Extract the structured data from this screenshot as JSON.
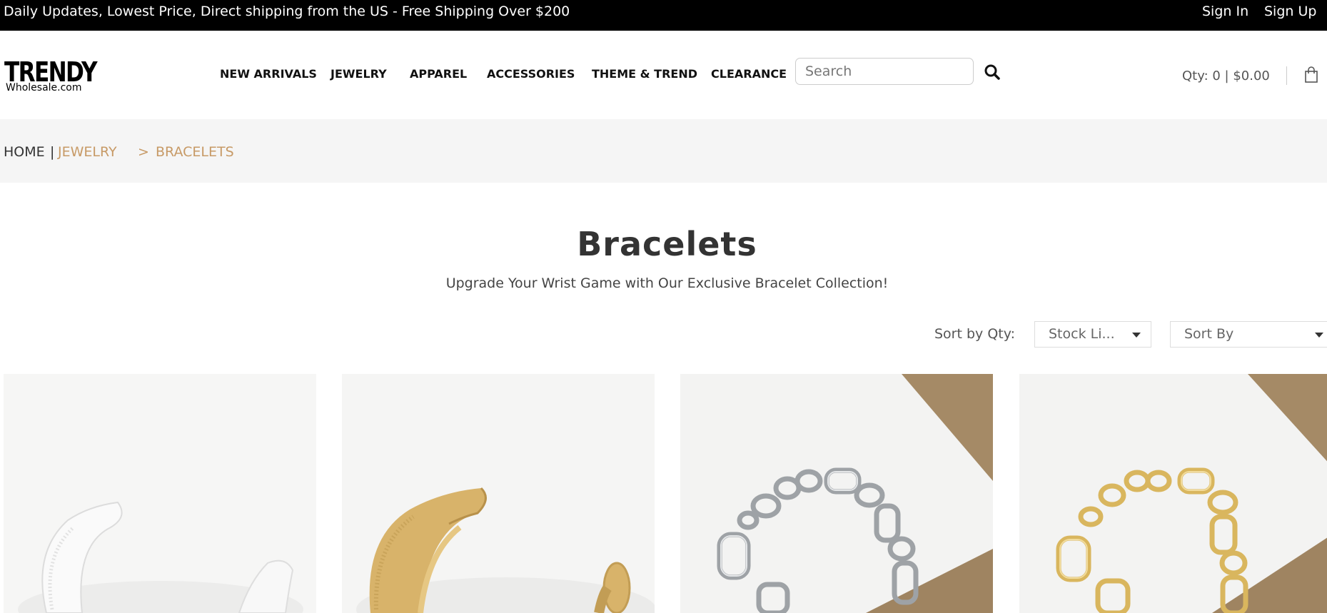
{
  "topbar": {
    "promo": "Daily Updates, Lowest Price, Direct shipping from the US - Free Shipping Over $200",
    "sign_in": "Sign In",
    "sign_up": "Sign Up"
  },
  "header": {
    "logo_main": "TRENDY",
    "logo_sub": "Wholesale.com",
    "nav": [
      "NEW ARRIVALS",
      "JEWELRY",
      "APPAREL",
      "ACCESSORIES",
      "THEME & TREND",
      "CLEARANCE"
    ],
    "search_placeholder": "Search",
    "cart": "Qty: 0 | $0.00"
  },
  "breadcrumb": {
    "home": "HOME",
    "separator": "|",
    "jewelry": "JEWELRY",
    "arrow": ">",
    "current": "BRACELETS"
  },
  "main": {
    "title": "Bracelets",
    "subtitle": "Upgrade Your Wrist Game with Our Exclusive Bracelet Collection!"
  },
  "sort": {
    "label": "Sort by Qty:",
    "stock_value": "Stock Li...",
    "sort_by_value": "Sort By"
  },
  "colors": {
    "accent": "#c79a66",
    "topbar_bg": "#000000",
    "crumb_bg": "#f5f5f5"
  },
  "products": [
    {
      "image": "white-cuff-bracelet"
    },
    {
      "image": "gold-cuff-bracelet"
    },
    {
      "image": "silver-chain-bracelet"
    },
    {
      "image": "gold-chain-bracelet"
    }
  ]
}
